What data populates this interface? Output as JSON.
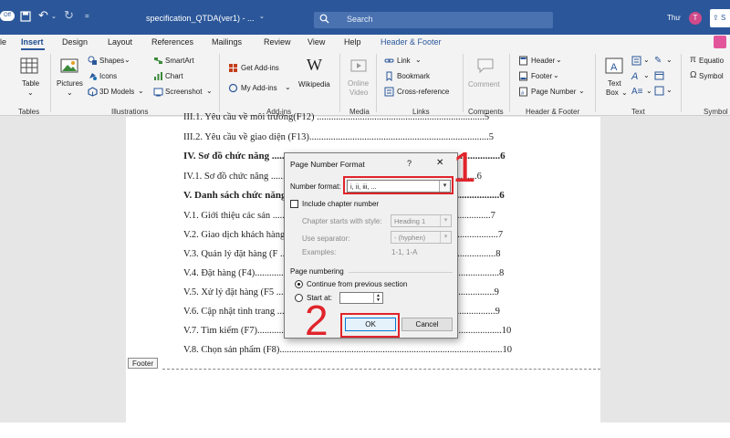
{
  "titlebar": {
    "doc_title": "specification_QTDA(ver1)  - ...",
    "search_placeholder": "Search",
    "user_name": "Thư",
    "avatar_initial": "T",
    "share_label": "S",
    "autosave_label": "Off"
  },
  "tabs": [
    "le",
    "Insert",
    "Design",
    "Layout",
    "References",
    "Mailings",
    "Review",
    "View",
    "Help",
    "Header & Footer"
  ],
  "ribbon": {
    "tables": {
      "table": "Table",
      "group": "Tables"
    },
    "illustrations": {
      "pictures": "Pictures",
      "shapes": "Shapes",
      "icons": "Icons",
      "models": "3D Models",
      "smartart": "SmartArt",
      "chart": "Chart",
      "screenshot": "Screenshot",
      "group": "Illustrations"
    },
    "addins": {
      "get": "Get Add-ins",
      "my": "My Add-ins",
      "wikipedia": "Wikipedia",
      "group": "Add-ins"
    },
    "media": {
      "online_video_1": "Online",
      "online_video_2": "Video",
      "group": "Media"
    },
    "links": {
      "link": "Link",
      "bookmark": "Bookmark",
      "cross": "Cross-reference",
      "group": "Links"
    },
    "comments": {
      "comment": "Comment",
      "group": "Comments"
    },
    "header_footer": {
      "header": "Header",
      "footer": "Footer",
      "page_number": "Page Number",
      "group": "Header & Footer"
    },
    "text": {
      "textbox_1": "Text",
      "textbox_2": "Box",
      "group": "Text"
    },
    "symbols": {
      "equation": "Equatio",
      "symbol": "Symbol",
      "group": "Symbol"
    }
  },
  "document": {
    "toc": [
      {
        "text": "III.1. Yêu cầu về môi trường(F12) ......................................................................5",
        "bold": false
      },
      {
        "text": "III.2. Yêu cầu về giao diện (F13)...........................................................................5",
        "bold": false
      },
      {
        "text": "IV. Sơ đồ chức năng ...........................................................................................6",
        "bold": true
      },
      {
        "text": "IV.1. Sơ đồ chức năng ......................................................................................6",
        "bold": false
      },
      {
        "text": "V. Danh sách chức năng ....................................................................................6",
        "bold": true
      },
      {
        "text": "V.1. Giới thiệu các sản ...........................................................................................7",
        "bold": false
      },
      {
        "text": "V.2. Giao dịch khách hàng ........................................................................................7",
        "bold": false
      },
      {
        "text": "V.3. Quản lý đặt hàng (F ..........................................................................................8",
        "bold": false
      },
      {
        "text": "V.4. Đặt hàng (F4)......................................................................................................8",
        "bold": false
      },
      {
        "text": "V.5. Xử lý đặt hàng (F5 ...........................................................................................9",
        "bold": false
      },
      {
        "text": "V.6. Cập nhật tình trang ...........................................................................................9",
        "bold": false
      },
      {
        "text": "V.7. Tìm kiếm (F7)......................................................................................................10",
        "bold": false
      },
      {
        "text": "V.8. Chọn sản phẩm (F8).............................................................................................10",
        "bold": false
      }
    ],
    "footer_label": "Footer"
  },
  "dialog": {
    "title": "Page Number Format",
    "help": "?",
    "close": "✕",
    "number_format_label": "Number format:",
    "number_format_value": "i, ii, iii, ...",
    "include_chapter": "Include chapter number",
    "chapter_style_label": "Chapter starts with style:",
    "chapter_style_value": "Heading 1",
    "separator_label": "Use separator:",
    "separator_value": "-   (hyphen)",
    "examples_label": "Examples:",
    "examples_value": "1-1, 1-A",
    "page_numbering_label": "Page numbering",
    "continue_label": "Continue from previous section",
    "start_at_label": "Start at:",
    "start_at_value": "",
    "ok": "OK",
    "cancel": "Cancel"
  },
  "annotations": {
    "step1": "1",
    "step2": "2"
  },
  "colors": {
    "word_blue": "#2b579a",
    "annotation_red": "#e0242b"
  }
}
